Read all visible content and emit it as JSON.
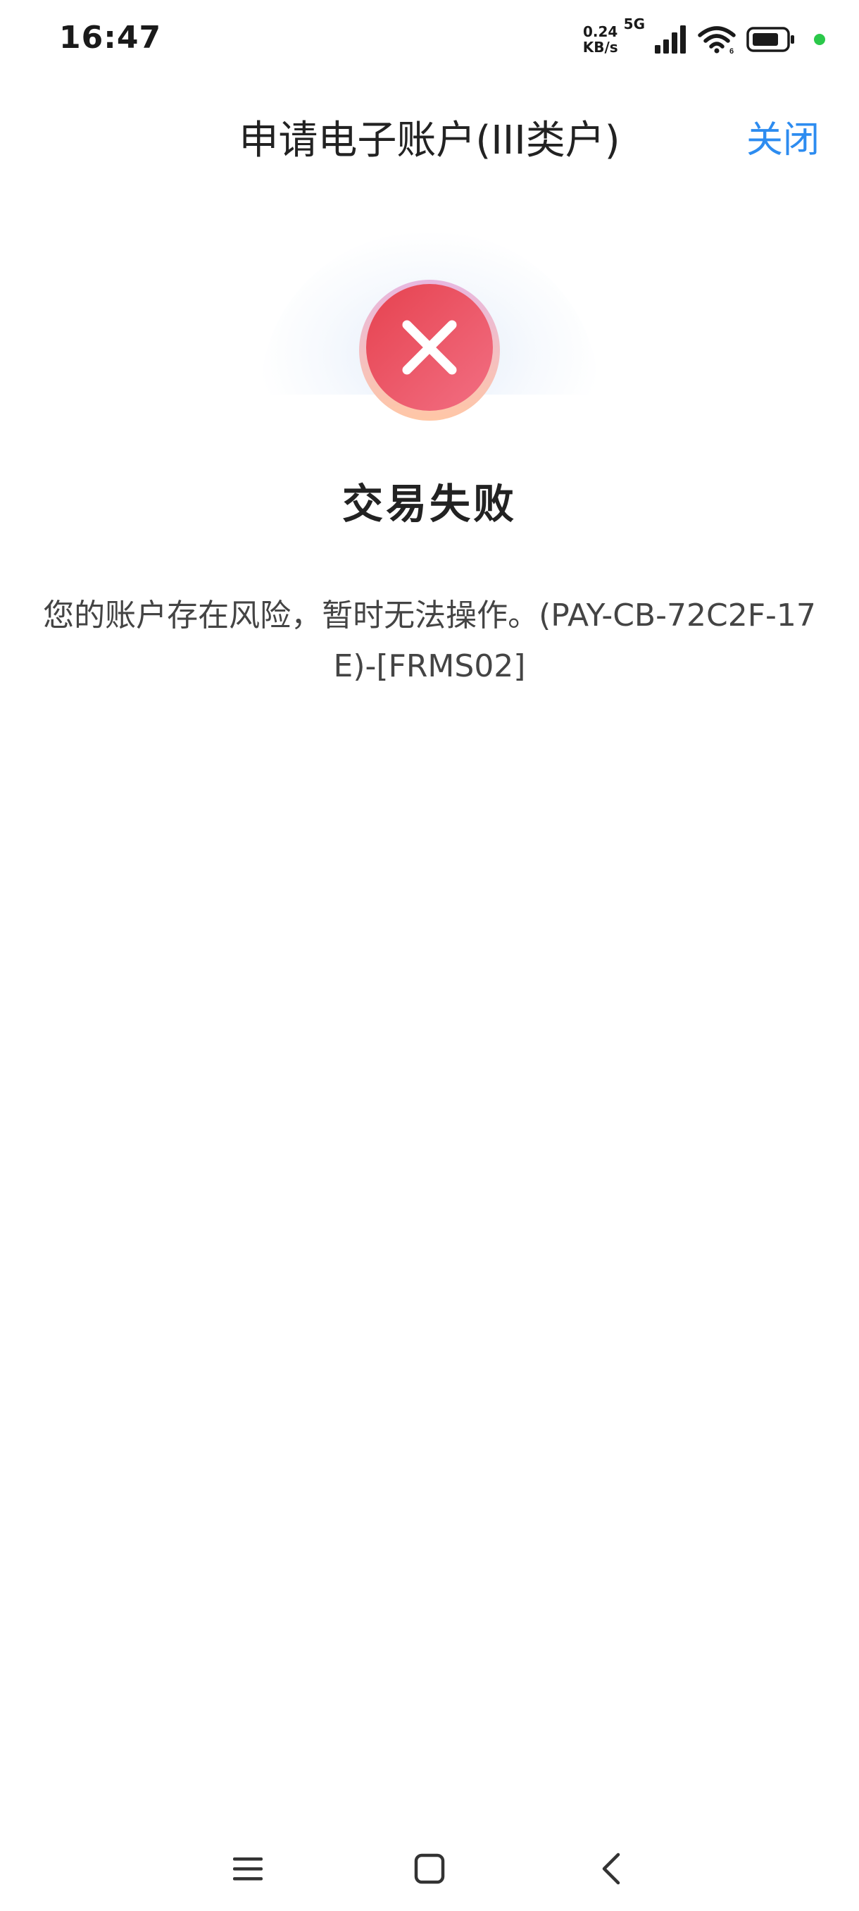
{
  "status_bar": {
    "time": "16:47",
    "net_speed_value": "0.24",
    "net_speed_unit": "KB/s",
    "network_type": "5G",
    "icons": [
      "signal-icon",
      "wifi-icon",
      "battery-icon"
    ],
    "indicator_color": "#2bc84a"
  },
  "header": {
    "title": "申请电子账户(III类户)",
    "close_label": "关闭",
    "accent_color": "#2d8cf0"
  },
  "result": {
    "icon": "error-x-icon",
    "title": "交易失败",
    "message": "您的账户存在风险，暂时无法操作。(PAY-CB-72C2F-17E)-[FRMS02]",
    "icon_color": "#ea4a5a"
  },
  "nav_bar": {
    "icons": [
      "menu-icon",
      "home-icon",
      "back-icon"
    ]
  }
}
